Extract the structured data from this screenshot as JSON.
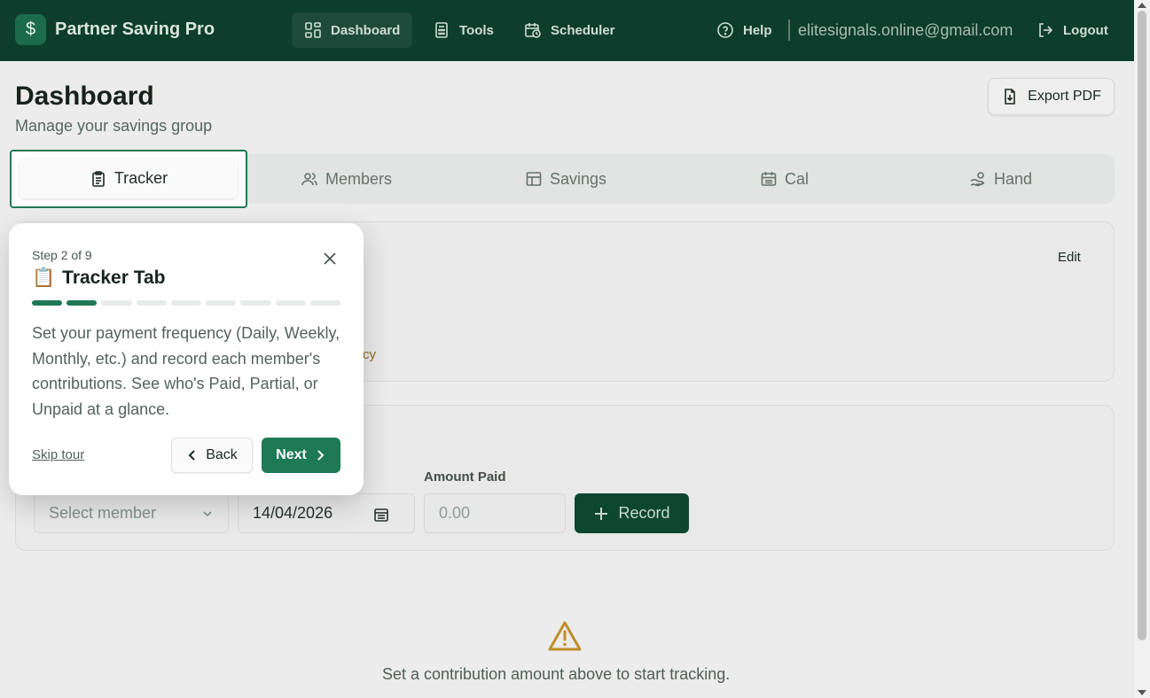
{
  "header": {
    "logo_glyph": "$",
    "brand": "Partner Saving Pro",
    "nav": [
      {
        "label": "Dashboard",
        "icon": "grid-icon",
        "active": true
      },
      {
        "label": "Tools",
        "icon": "calculator-icon",
        "active": false
      },
      {
        "label": "Scheduler",
        "icon": "calendar-clock-icon",
        "active": false
      }
    ],
    "help": "Help",
    "email": "elitesignals.online@gmail.com",
    "logout": "Logout"
  },
  "page": {
    "title": "Dashboard",
    "subtitle": "Manage your savings group",
    "export": "Export PDF"
  },
  "tabs": [
    {
      "label": "Tracker",
      "icon": "clipboard-icon",
      "active": true
    },
    {
      "label": "Members",
      "icon": "users-icon",
      "active": false
    },
    {
      "label": "Savings",
      "icon": "table-icon",
      "active": false
    },
    {
      "label": "Cal",
      "icon": "calendar-icon",
      "active": false
    },
    {
      "label": "Hand",
      "icon": "hand-coins-icon",
      "active": false
    }
  ],
  "settings_card": {
    "edit": "Edit",
    "partial_text": "cy"
  },
  "record_form": {
    "amount_label": "Amount Paid",
    "member_placeholder": "Select member",
    "date_value": "14/04/2026",
    "amount_placeholder": "0.00",
    "record_button": "Record"
  },
  "empty_state": {
    "message": "Set a contribution amount above to start tracking."
  },
  "tour": {
    "step": "Step 2 of 9",
    "emoji": "📋",
    "title": "Tracker Tab",
    "progress_total": 9,
    "progress_current": 2,
    "body": "Set your payment frequency (Daily, Weekly, Monthly, etc.) and record each member's contributions. See who's Paid, Partial, or Unpaid at a glance.",
    "skip": "Skip tour",
    "back": "Back",
    "next": "Next"
  },
  "colors": {
    "header_bg": "#0d3d2c",
    "accent": "#1e7a55",
    "record_bg": "#0f4a33",
    "warning": "#c9932b"
  }
}
